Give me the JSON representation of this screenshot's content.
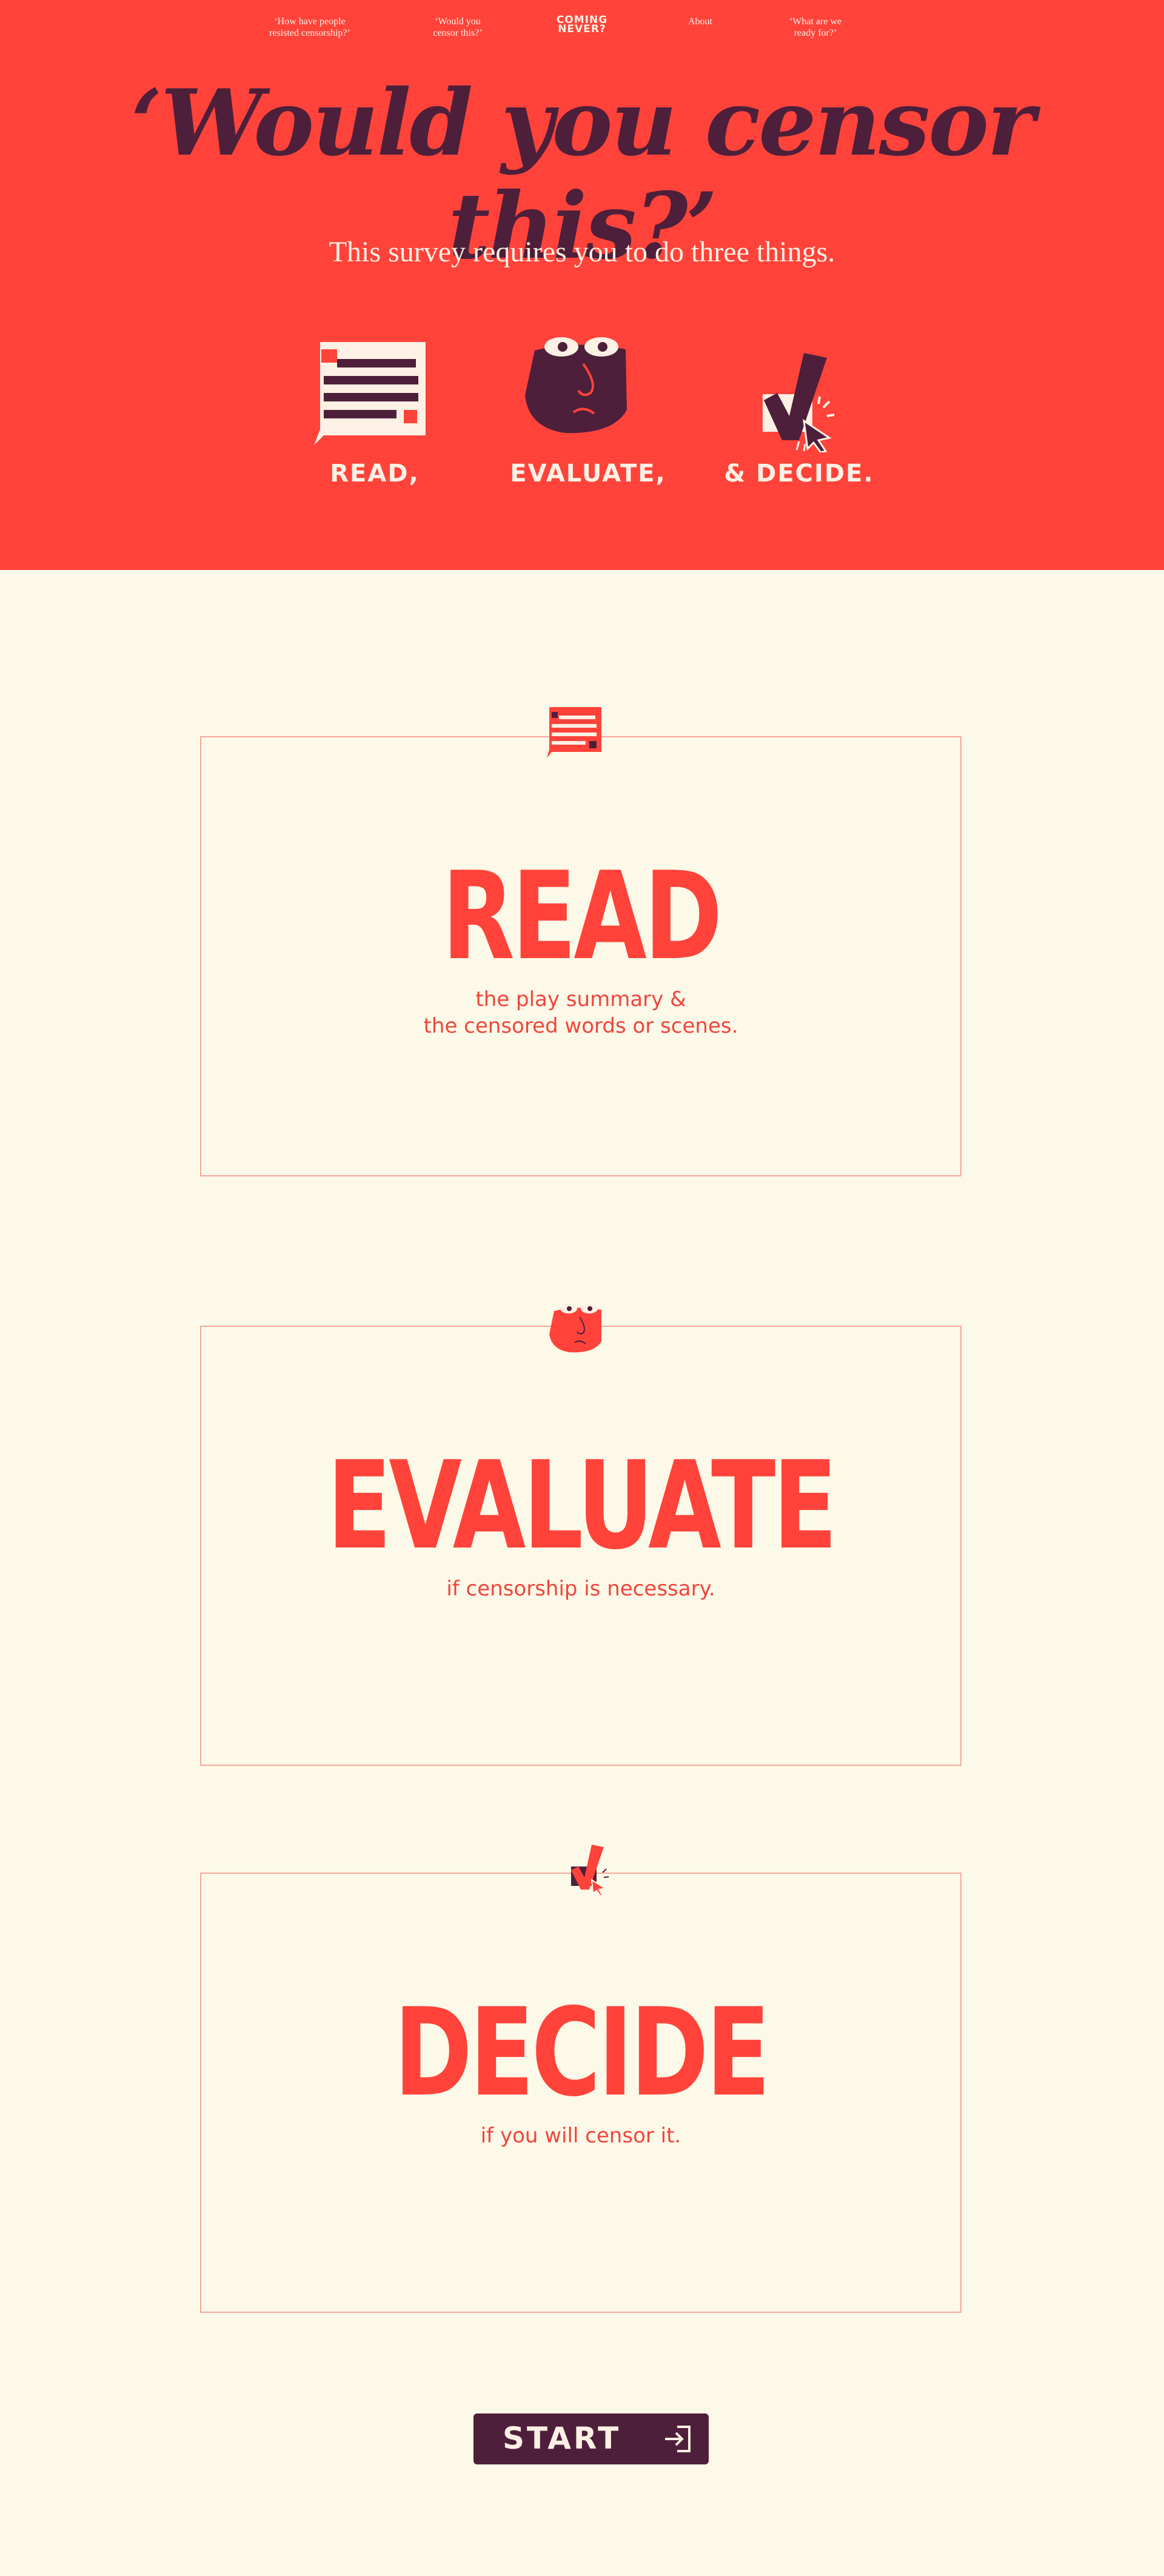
{
  "nav": {
    "items": [
      {
        "label": "‘How have people\nresisted censorship?’"
      },
      {
        "label": "‘Would you\ncensor this?’"
      },
      {
        "label": "About"
      },
      {
        "label": "‘What are we\nready for?’"
      }
    ],
    "logo": "COMING\nNEVER?"
  },
  "hero": {
    "title": "‘Would you censor this?’",
    "subtitle": "This survey requires you to do three things.",
    "steps": [
      {
        "label": "READ,",
        "icon": "speech-bubble-icon"
      },
      {
        "label": "EVALUATE,",
        "icon": "face-icon"
      },
      {
        "label": "& DECIDE.",
        "icon": "checkmark-cursor-icon"
      }
    ]
  },
  "cards": [
    {
      "heading": "READ",
      "text": "the play summary &\nthe censored words or scenes.",
      "icon": "speech-bubble-icon"
    },
    {
      "heading": "EVALUATE",
      "text": "if censorship is necessary.",
      "icon": "face-icon"
    },
    {
      "heading": "DECIDE",
      "text": "if you will censor it.",
      "icon": "checkmark-cursor-icon"
    }
  ],
  "start_button": {
    "label": "START",
    "icon": "enter-door-icon"
  },
  "colors": {
    "hero_red": "#ff433a",
    "plum": "#4d1f3a",
    "cream": "#fdf9e8",
    "card_border": "#f7a79b"
  }
}
